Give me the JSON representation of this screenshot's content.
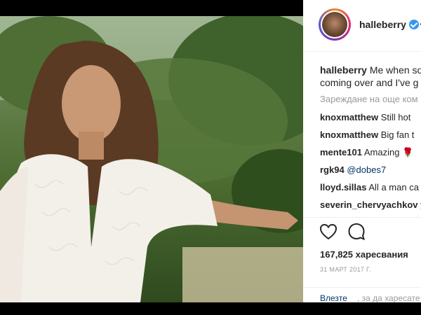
{
  "post": {
    "author": "halleberry",
    "caption_user": "halleberry",
    "caption_text": "Me when so",
    "caption_text_line2": "coming over and I've g",
    "load_more": "Зареждане на още ком",
    "comments": [
      {
        "user": "knoxmatthew",
        "text": "Still hot"
      },
      {
        "user": "knoxmatthew",
        "text": "Big fan t"
      },
      {
        "user": "mente101",
        "text": "Amazing 🌹"
      },
      {
        "user": "rgk94",
        "text": "@dobes7"
      },
      {
        "user": "lloyd.sillas",
        "text": "All a man ca"
      },
      {
        "user": "severin_chervyachkov",
        "text": "y"
      }
    ],
    "likes": "167,825 харесвания",
    "date": "31 МАРТ 2017 Г.",
    "login_link": "Влезте",
    "login_rest": ", за да харесате"
  },
  "icons": {
    "like": "heart-outline-icon",
    "comment": "speech-bubble-icon",
    "verified": "verified-badge-icon",
    "more": "more-options-icon"
  },
  "colors": {
    "verified": "#3897f0",
    "link": "#003569",
    "muted": "#999999",
    "text": "#262626"
  }
}
